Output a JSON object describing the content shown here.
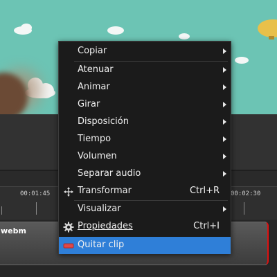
{
  "colors": {
    "sky": "#6cc4b4",
    "menu_bg": "#1b1b1b",
    "selection": "#2f7fd8",
    "clip_border": "#dd1111"
  },
  "timeline": {
    "ruler_labels": [
      "00:01:45",
      "00:02:30"
    ],
    "clip_label": "webm"
  },
  "menu": {
    "items": [
      {
        "label": "Copiar",
        "submenu": true
      },
      {
        "label": "Atenuar",
        "submenu": true
      },
      {
        "label": "Animar",
        "submenu": true
      },
      {
        "label": "Girar",
        "submenu": true
      },
      {
        "label": "Disposición",
        "submenu": true
      },
      {
        "label": "Tiempo",
        "submenu": true
      },
      {
        "label": "Volumen",
        "submenu": true
      },
      {
        "label": "Separar audio",
        "submenu": true
      },
      {
        "label": "Transformar",
        "shortcut": "Ctrl+R",
        "icon": "move-arrows-icon"
      },
      {
        "label": "Visualizar",
        "submenu": true
      },
      {
        "label": "Propiedades",
        "shortcut": "Ctrl+I",
        "icon": "gear-icon"
      },
      {
        "label": "Quitar clip",
        "icon": "remove-icon",
        "selected": true
      }
    ]
  }
}
